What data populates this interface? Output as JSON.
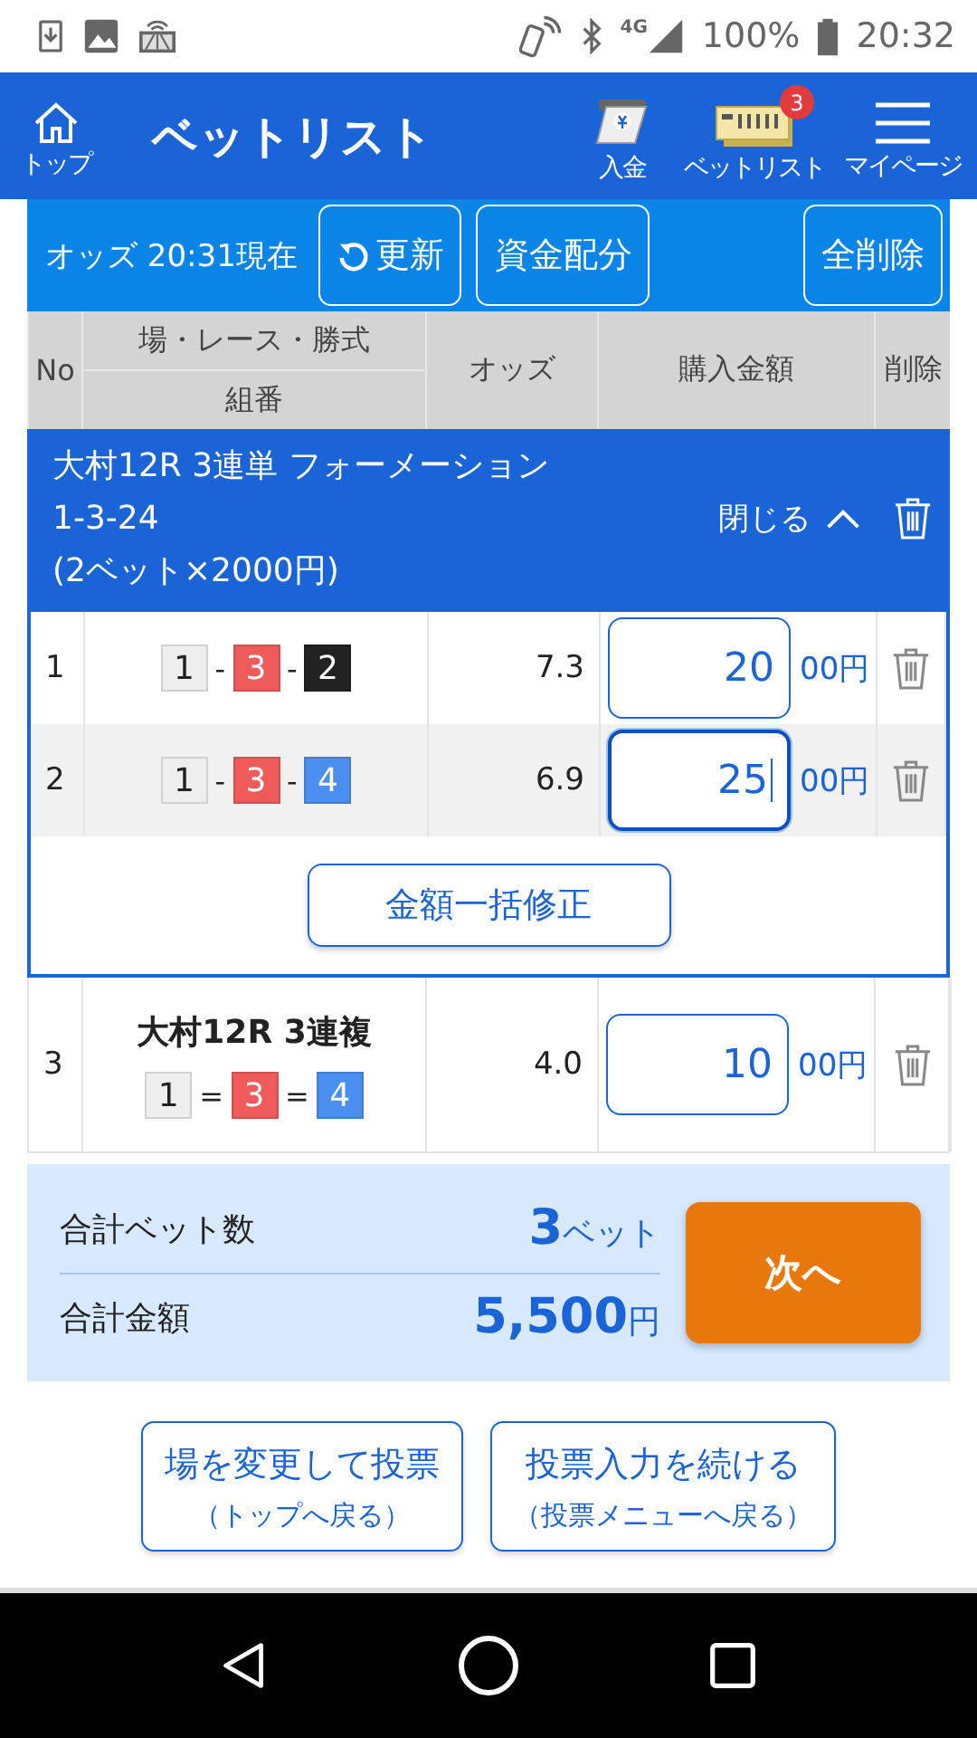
{
  "status_bar": {
    "network": "4G",
    "battery": "100%",
    "time": "20:32"
  },
  "header": {
    "home_label": "トップ",
    "title": "ベットリスト",
    "actions": [
      {
        "kind": "deposit",
        "label": "入金"
      },
      {
        "kind": "betlist",
        "label": "ベットリスト",
        "badge": "3"
      },
      {
        "kind": "menu",
        "label": "マイページ"
      }
    ]
  },
  "toolbar": {
    "odds_time": "オッズ 20:31現在",
    "refresh": "更新",
    "allocate": "資金配分",
    "delete_all": "全削除"
  },
  "table": {
    "columns": [
      {
        "kind": "no",
        "label": "No"
      },
      {
        "kind": "race",
        "label": "場・レース・勝式",
        "sub": "組番"
      },
      {
        "kind": "odds",
        "label": "オッズ"
      },
      {
        "kind": "amount",
        "label": "購入金額"
      },
      {
        "kind": "delete",
        "label": "削除"
      }
    ],
    "groups": [
      {
        "title": "大村12R 3連単 フォーメーション",
        "combo": "1-3-24",
        "detail": "(2ベット×2000円)",
        "toggle": "閉じる",
        "expanded": true,
        "bulk_button": "金額一括修正",
        "rows": [
          {
            "no": "1",
            "separator": "-",
            "boats": [
              {
                "number": "1",
                "color": "#eeeeee"
              },
              {
                "number": "3",
                "color": "#ef5a5a"
              },
              {
                "number": "2",
                "color": "#222222"
              }
            ],
            "odds": "7.3",
            "amount": "20",
            "unit": "00円",
            "focused": false
          },
          {
            "no": "2",
            "separator": "-",
            "boats": [
              {
                "number": "1",
                "color": "#eeeeee"
              },
              {
                "number": "3",
                "color": "#ef5a5a"
              },
              {
                "number": "4",
                "color": "#4a8ef0"
              }
            ],
            "odds": "6.9",
            "amount": "25",
            "unit": "00円",
            "focused": true
          }
        ]
      }
    ],
    "singles": [
      {
        "no": "3",
        "title": "大村12R 3連複",
        "separator": "=",
        "boats": [
          {
            "number": "1",
            "color": "#eeeeee"
          },
          {
            "number": "3",
            "color": "#ef5a5a"
          },
          {
            "number": "4",
            "color": "#4a8ef0"
          }
        ],
        "odds": "4.0",
        "amount": "10",
        "unit": "00円",
        "focused": false
      }
    ]
  },
  "summary": {
    "count_label": "合計ベット数",
    "count_value": "3",
    "count_unit": "ベット",
    "total_label": "合計金額",
    "total_value": "5,500",
    "total_unit": "円",
    "next": "次へ"
  },
  "footer_buttons": [
    {
      "label": "場を変更して投票",
      "sub": "（トップへ戻る）"
    },
    {
      "label": "投票入力を続ける",
      "sub": "（投票メニューへ戻る）"
    }
  ]
}
